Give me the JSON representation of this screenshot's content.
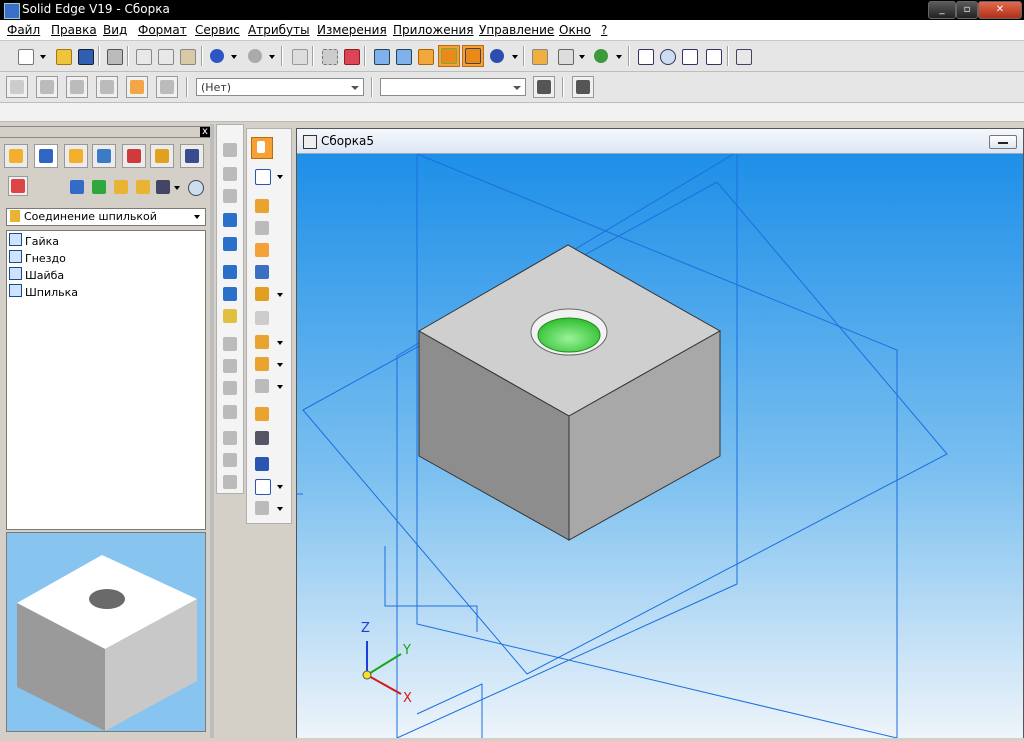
{
  "window": {
    "title": "Solid Edge V19 - Сборка",
    "min": "_",
    "max": "▫",
    "close": "✕"
  },
  "menu": [
    "Файл",
    "Правка",
    "Вид",
    "Формат",
    "Сервис",
    "Атрибуты",
    "Измерения",
    "Приложения",
    "Управление",
    "Окно",
    "?"
  ],
  "toolbar": {
    "layer_combo": "(Нет)",
    "style_combo": ""
  },
  "assembly": {
    "selector": "Соединение шпилькой",
    "parts": [
      "Гайка",
      "Гнездо",
      "Шайба",
      "Шпилька"
    ]
  },
  "document": {
    "title": "Сборка5"
  },
  "triad": {
    "z": "Z",
    "y": "Y",
    "x": "X"
  },
  "colors": {
    "title_bar": "#000000",
    "viewport_top": "#1e8fe8",
    "viewport_bottom": "#eef4fa",
    "block_top": "#cfcfcf",
    "block_left": "#8d8d8d",
    "block_right": "#a8a8a8",
    "hole": "#48d948",
    "plane_lines": "#1a6fe0",
    "active_tool": "#f7a035"
  },
  "icons": [
    "new-icon",
    "open-icon",
    "save-icon",
    "print-icon",
    "cut-icon",
    "copy-icon",
    "paste-icon",
    "undo-icon",
    "redo-icon",
    "select-icon",
    "zoom-icon",
    "fit-icon",
    "help-icon",
    "nut-icon",
    "socket-icon",
    "washer-icon",
    "stud-icon"
  ]
}
